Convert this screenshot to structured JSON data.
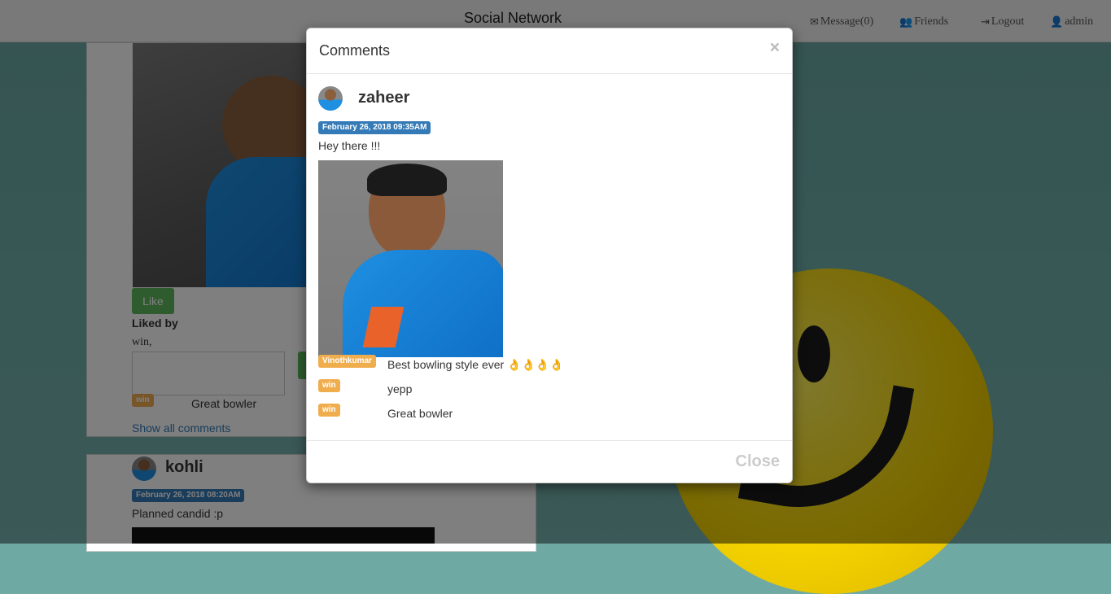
{
  "navbar": {
    "brand": "Social Network",
    "message": "Message(0)",
    "friends": "Friends",
    "logout": "Logout",
    "user": "admin"
  },
  "feed": {
    "post1": {
      "like_label": "Like",
      "liked_by_label": "Liked by",
      "liked_by_users": "win,",
      "comment_user": "win",
      "comment_text": "Great bowler",
      "show_all": "Show all comments"
    },
    "post2": {
      "author": "kohli",
      "date": "February 26, 2018 08:20AM",
      "text": "Planned candid :p"
    }
  },
  "modal": {
    "title": "Comments",
    "close_x": "×",
    "author": "zaheer",
    "date": "February 26, 2018 09:35AM",
    "post_text": "Hey there !!!",
    "comments": [
      {
        "user": "Vinothkumar",
        "text": "Best bowling style ever 👌👌👌👌"
      },
      {
        "user": "win",
        "text": "yepp"
      },
      {
        "user": "win",
        "text": "Great bowler"
      }
    ],
    "close_label": "Close"
  },
  "colors": {
    "label_blue": "#337ab7",
    "label_warning": "#f0ad4e",
    "like_green": "#5cb85c"
  }
}
